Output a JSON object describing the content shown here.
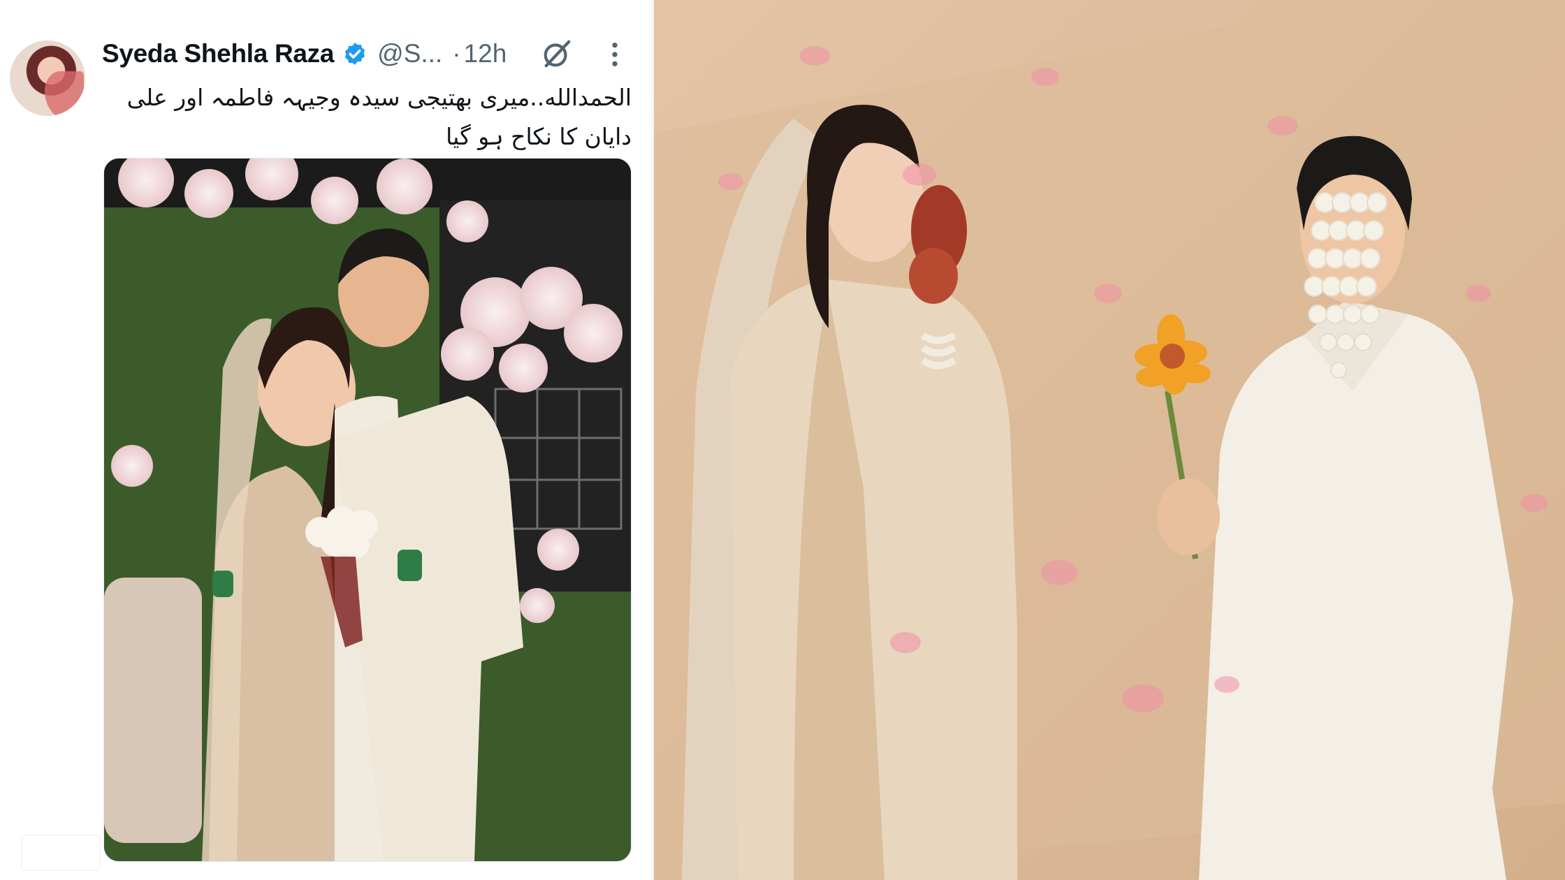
{
  "tweet": {
    "author_name": "Syeda Shehla Raza",
    "handle": "@S...",
    "separator": "·",
    "time": "12h",
    "text_line1": "الحمدالله..میری بھتیجی سیدہ وجیہہ فاطمہ اور علی",
    "text_line2": "دایان کا نکاح ہو گیا",
    "icons": {
      "verified": "verified-badge-icon",
      "grok": "grok-icon",
      "more": "more-options-icon"
    }
  },
  "colors": {
    "verified_blue": "#1d9bf0",
    "text_primary": "#0f1419",
    "text_secondary": "#536471"
  }
}
